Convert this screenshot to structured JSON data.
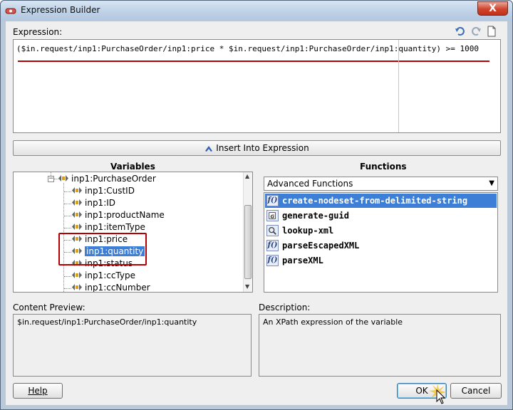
{
  "window": {
    "title": "Expression Builder",
    "close_label": "X"
  },
  "expression": {
    "label": "Expression:",
    "value": "($in.request/inp1:PurchaseOrder/inp1:price * $in.request/inp1:PurchaseOrder/inp1:quantity) >= 1000",
    "tools": [
      "undo-icon",
      "redo-icon",
      "new-document-icon"
    ]
  },
  "insert_button": {
    "label": "Insert Into Expression"
  },
  "variables": {
    "title": "Variables",
    "tree": [
      {
        "label": "inp1:PurchaseOrder"
      },
      {
        "label": "inp1:CustID"
      },
      {
        "label": "inp1:ID"
      },
      {
        "label": "inp1:productName"
      },
      {
        "label": "inp1:itemType"
      },
      {
        "label": "inp1:price"
      },
      {
        "label": "inp1:quantity"
      },
      {
        "label": "inp1:status"
      },
      {
        "label": "inp1:ccType"
      },
      {
        "label": "inp1:ccNumber"
      }
    ]
  },
  "functions": {
    "title": "Functions",
    "category": "Advanced Functions",
    "items": [
      {
        "label": "create-nodeset-from-delimited-string",
        "icon": "function-icon"
      },
      {
        "label": "generate-guid",
        "icon": "guid-icon"
      },
      {
        "label": "lookup-xml",
        "icon": "lookup-icon"
      },
      {
        "label": "parseEscapedXML",
        "icon": "function-icon"
      },
      {
        "label": "parseXML",
        "icon": "function-icon"
      }
    ]
  },
  "content_preview": {
    "label": "Content Preview:",
    "value": "$in.request/inp1:PurchaseOrder/inp1:quantity"
  },
  "description": {
    "label": "Description:",
    "value": "An XPath expression of the variable"
  },
  "buttons": {
    "help": "Help",
    "ok": "OK",
    "cancel": "Cancel"
  },
  "colors": {
    "accent": "#3d7fd6",
    "highlight_border": "#b40000"
  }
}
